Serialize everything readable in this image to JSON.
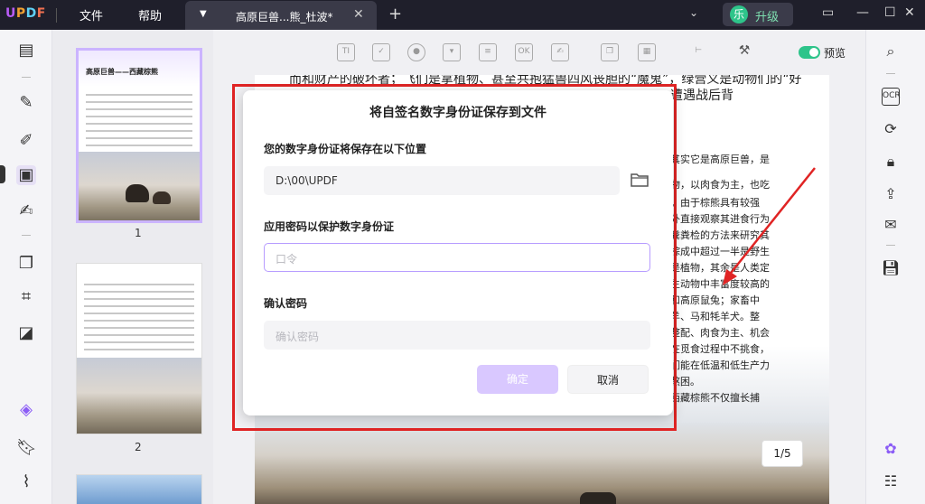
{
  "titlebar": {
    "menus": [
      "文件",
      "帮助"
    ],
    "tab_title": "高原巨兽...熊_杜波*",
    "upgrade_avatar": "乐",
    "upgrade_label": "升级"
  },
  "toolbar": {
    "preview_label": "预览",
    "preview_on": true
  },
  "thumbnails": {
    "page1_title": "高原巨兽——西藏棕熊",
    "items": [
      {
        "number": "1",
        "selected": true
      },
      {
        "number": "2",
        "selected": false
      }
    ]
  },
  "document": {
    "lines": [
      "而和财产的破坏者；飞们是拿植物、甚至共抱猛兽四风丧胆的“魔鬼”，绿营义是动物们的“好",
      "遭遇战后背",
      "其实它是高原巨兽，是",
      "物，以肉食为主，也吃",
      "。由于棕熊具有较强",
      "外直接观察其进食行为",
      "粪粪检的方法来研究其",
      "棕成中超过一半是野生",
      "是植物，其余是人类定",
      "生动物中丰富度较高的",
      "和高原鼠兔；家畜中",
      "羊、马和牦羊犬。整",
      "整配、肉食为主、机会",
      "在觅食过程中不挑食，",
      "们能在低温和低生产力",
      "熬困。",
      "西藏棕熊不仅擅长捕"
    ],
    "page_indicator": "1/5"
  },
  "dialog": {
    "title": "将自签名数字身份证保存到文件",
    "location_label": "您的数字身份证将保存在以下位置",
    "location_value": "D:\\00\\UPDF",
    "password_label": "应用密码以保护数字身份证",
    "password_placeholder": "口令",
    "confirm_label": "确认密码",
    "confirm_placeholder": "确认密码",
    "ok_label": "确定",
    "cancel_label": "取消"
  },
  "colors": {
    "accent": "#b79cff",
    "primary_disabled": "#d9c8ff",
    "toggle_on": "#2ec48a",
    "annotation_red": "#e02424"
  }
}
